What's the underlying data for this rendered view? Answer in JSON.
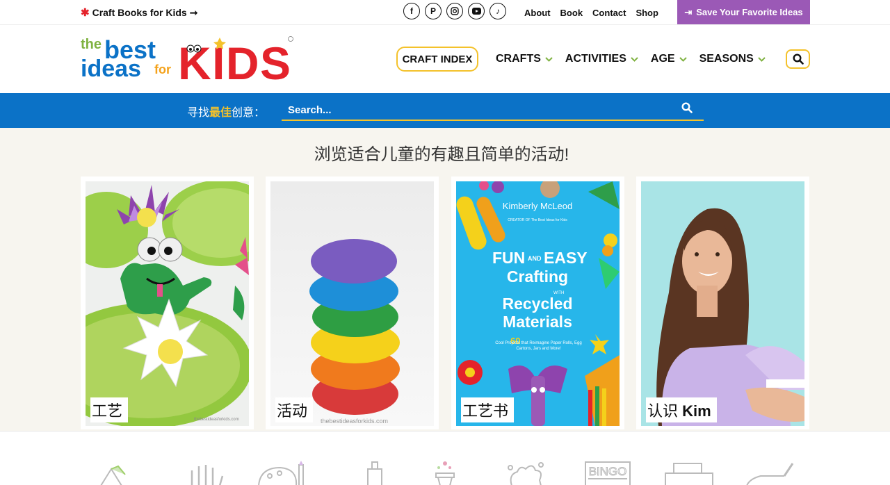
{
  "topbar": {
    "promo": "Craft Books for Kids",
    "social": [
      "facebook-icon",
      "pinterest-icon",
      "instagram-icon",
      "youtube-icon",
      "tiktok-icon"
    ],
    "links": [
      "About",
      "Book",
      "Contact",
      "Shop"
    ],
    "save_label": "Save Your Favorite Ideas"
  },
  "header": {
    "logo": {
      "the": "the",
      "best": "best",
      "ideas": "ideas",
      "for": "for",
      "kids": "KIDS"
    },
    "craft_index": "CRAFT INDEX",
    "nav": [
      "CRAFTS",
      "ACTIVITIES",
      "AGE",
      "SEASONS"
    ]
  },
  "search": {
    "label_pre": "寻找",
    "label_hl": "最佳",
    "label_post": "创意：",
    "placeholder": "Search..."
  },
  "main": {
    "headline": "浏览适合儿童的有趣且简单的活动!",
    "cards": [
      {
        "label": "工艺",
        "watermark": "thebestideasforkids.com"
      },
      {
        "label": "活动",
        "watermark": "thebestideasforkids.com"
      },
      {
        "label": "工艺书"
      },
      {
        "label_pre": "认识 ",
        "label_bold": "Kim"
      }
    ],
    "book": {
      "author": "Kimberly McLeod",
      "creator": "CREATOR OF The Best Ideas for Kids",
      "title1": "FUN",
      "and": "AND",
      "title2": "EASY",
      "title3": "Crafting",
      "with": "WITH",
      "title4": "Recycled",
      "title5": "Materials",
      "sub_num": "60",
      "sub_text": "Cool Projects that Reimagine Paper Rolls, Egg Cartons, Jars and More!"
    }
  },
  "colors": {
    "accent_yellow": "#f4c22b",
    "blue": "#0b72c7",
    "purple": "#9b59b6",
    "green": "#7fb241"
  }
}
